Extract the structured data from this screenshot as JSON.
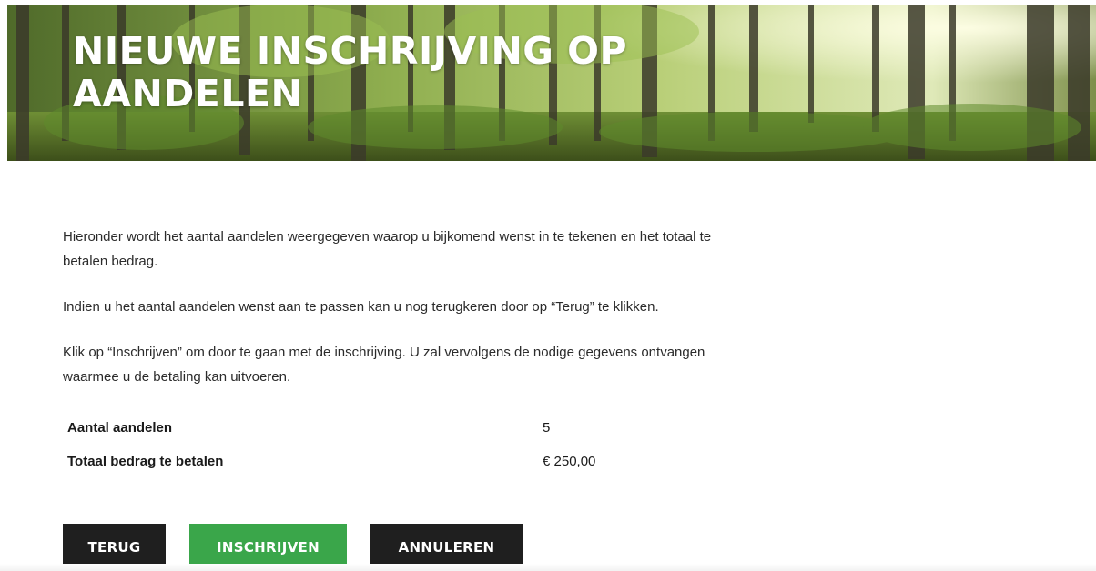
{
  "hero": {
    "title": "NIEUWE INSCHRIJVING OP AANDELEN",
    "image_icon": "forest-banner"
  },
  "intro": {
    "paragraph_1": "Hieronder wordt het aantal aandelen weergegeven waarop u bijkomend wenst in te tekenen en het totaal te betalen bedrag.",
    "paragraph_2": "Indien u het aantal aandelen wenst aan te passen kan u nog terugkeren door op “Terug” te klikken.",
    "paragraph_3": "Klik op “Inschrijven” om door te gaan met de inschrijving. U zal vervolgens de nodige gegevens ontvangen waarmee u de betaling kan uitvoeren."
  },
  "summary": {
    "rows": [
      {
        "label": "Aantal aandelen",
        "value": "5"
      },
      {
        "label": "Totaal bedrag te betalen",
        "value": "€ 250,00"
      }
    ]
  },
  "actions": {
    "back_label": "TERUG",
    "submit_label": "INSCHRIJVEN",
    "cancel_label": "ANNULEREN"
  },
  "colors": {
    "dark_button": "#1f1f1f",
    "primary_button": "#3aa64a",
    "text": "#2b2b2b"
  }
}
